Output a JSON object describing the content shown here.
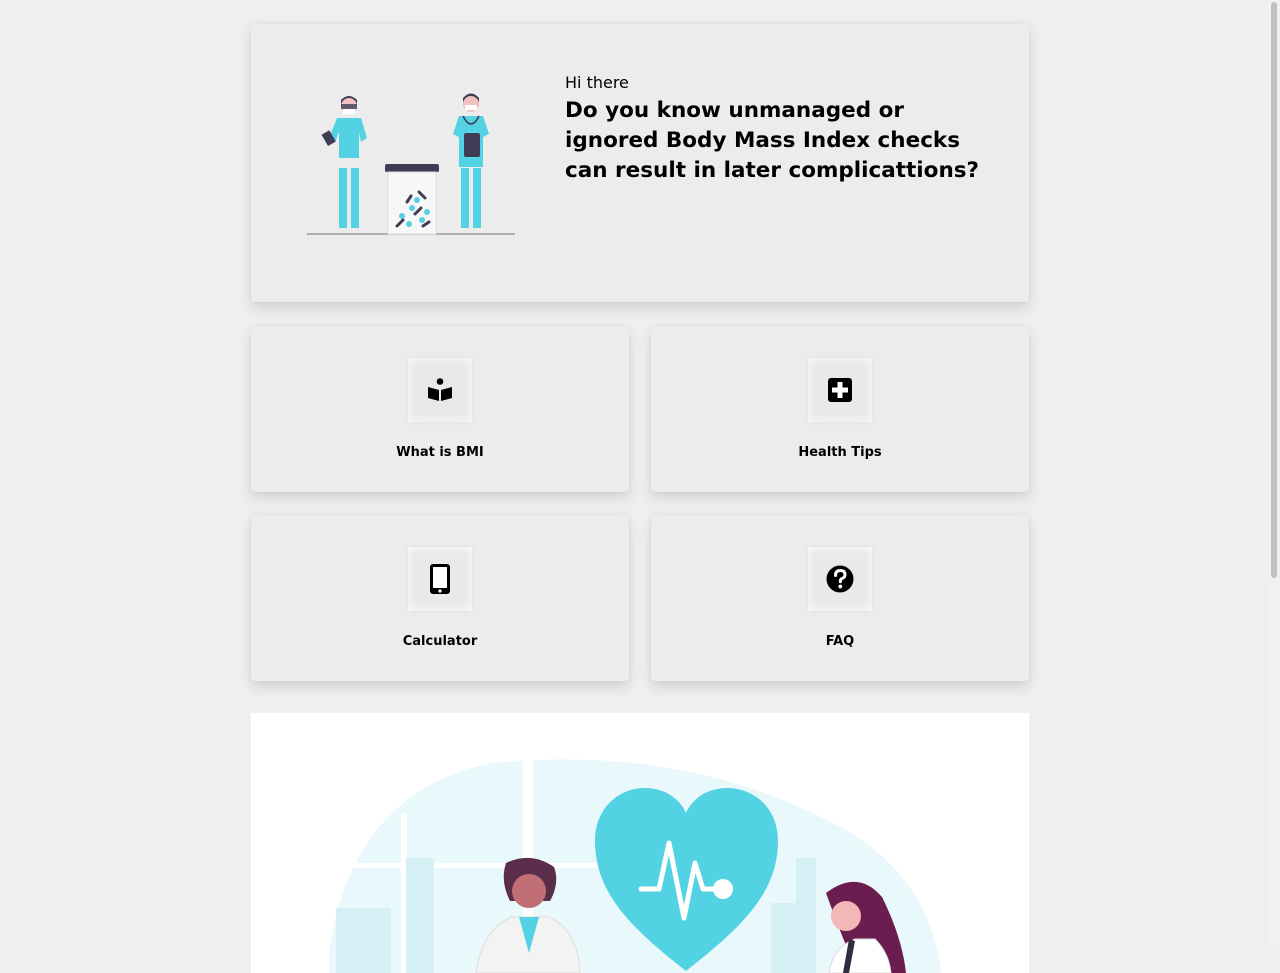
{
  "hero": {
    "greeting": "Hi there",
    "headline": "Do you know unmanaged or ignored Body Mass Index checks can result in later complicattions?"
  },
  "cards": [
    {
      "label": "What is BMI",
      "icon": "book-reader-icon"
    },
    {
      "label": "Health Tips",
      "icon": "medical-plus-icon"
    },
    {
      "label": "Calculator",
      "icon": "mobile-phone-icon"
    },
    {
      "label": "FAQ",
      "icon": "question-circle-icon"
    }
  ],
  "colors": {
    "background": "#efefef",
    "card": "#ececec",
    "accent": "#53d2e4",
    "dark": "#3f3d56"
  }
}
